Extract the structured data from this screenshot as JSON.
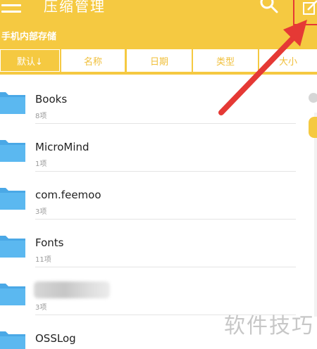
{
  "appbar": {
    "title": "压缩管理",
    "menu_icon": "hamburger-menu-icon",
    "search_icon": "search-icon",
    "edit_icon": "edit-icon",
    "color": "#f5c941"
  },
  "path": {
    "label": "手机内部存储"
  },
  "sort_tabs": [
    {
      "label": "默认↓",
      "active": true
    },
    {
      "label": "名称",
      "active": false
    },
    {
      "label": "日期",
      "active": false
    },
    {
      "label": "类型",
      "active": false
    },
    {
      "label": "大小",
      "active": false
    }
  ],
  "folders": [
    {
      "name": "Books",
      "count": "8项"
    },
    {
      "name": "MicroMind",
      "count": "1项"
    },
    {
      "name": "com.feemoo",
      "count": "3项"
    },
    {
      "name": "Fonts",
      "count": "11项"
    },
    {
      "name": "",
      "count": "3项",
      "blurred": true
    },
    {
      "name": "OSSLog",
      "count": ""
    }
  ],
  "watermark": "软件技巧",
  "colors": {
    "accent": "#f5c941",
    "folder": "#5bb8f0",
    "arrow": "#e53935"
  }
}
